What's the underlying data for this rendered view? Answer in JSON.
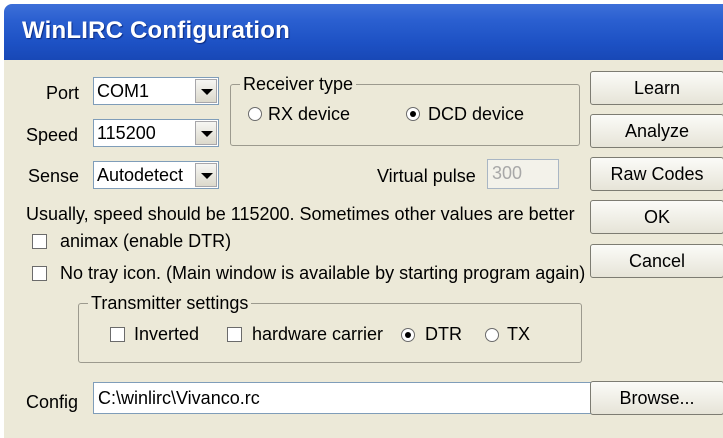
{
  "window": {
    "title": "WinLIRC Configuration"
  },
  "port": {
    "label": "Port",
    "value": "COM1"
  },
  "speed": {
    "label": "Speed",
    "value": "115200"
  },
  "sense": {
    "label": "Sense",
    "value": "Autodetect"
  },
  "receiver": {
    "legend": "Receiver type",
    "options": [
      {
        "label": "RX device",
        "selected": false
      },
      {
        "label": "DCD device",
        "selected": true
      }
    ]
  },
  "virtual_pulse": {
    "label": "Virtual pulse",
    "value": "300"
  },
  "hint": "Usually, speed should be 115200. Sometimes other values are better",
  "checkboxes": {
    "animax": {
      "label": "animax (enable DTR)",
      "checked": false
    },
    "no_tray": {
      "label": "No tray icon. (Main window is available by starting program again)",
      "checked": false
    }
  },
  "transmitter": {
    "legend": "Transmitter settings",
    "inverted": {
      "label": "Inverted",
      "checked": false
    },
    "hardware_carrier": {
      "label": "hardware carrier",
      "checked": false
    },
    "options": [
      {
        "label": "DTR",
        "selected": true
      },
      {
        "label": "TX",
        "selected": false
      }
    ]
  },
  "config": {
    "label": "Config",
    "value": "C:\\winlirc\\Vivanco.rc"
  },
  "buttons": {
    "learn": "Learn",
    "analyze": "Analyze",
    "raw_codes": "Raw Codes",
    "ok": "OK",
    "cancel": "Cancel",
    "browse": "Browse..."
  }
}
